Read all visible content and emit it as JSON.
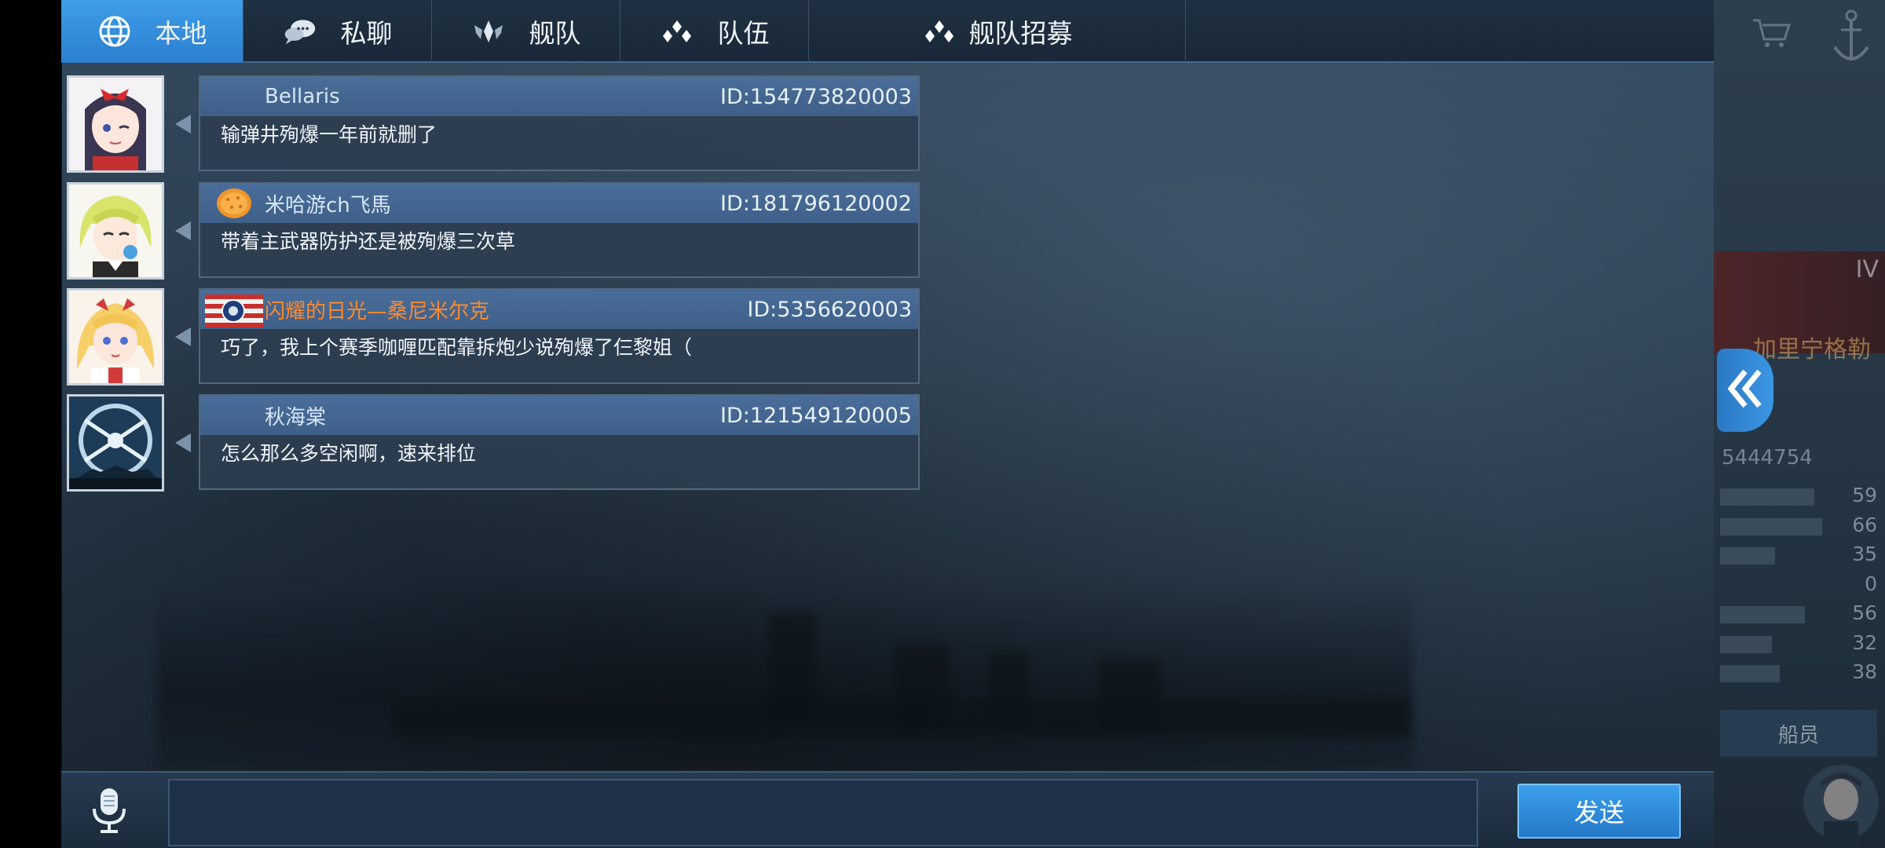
{
  "tabs": [
    {
      "label": "本地",
      "icon": "globe-icon",
      "active": true
    },
    {
      "label": "私聊",
      "icon": "chat-bubble-icon",
      "active": false
    },
    {
      "label": "舰队",
      "icon": "fleet-wings-icon",
      "active": false
    },
    {
      "label": "队伍",
      "icon": "team-dots-icon",
      "active": false
    },
    {
      "label": "舰队招募",
      "icon": "team-dots-icon",
      "active": false
    }
  ],
  "messages": [
    {
      "name": "Bellaris",
      "id": "ID:154773820003",
      "text": "输弹井殉爆一年前就删了",
      "name_color": "#d7e6f7",
      "badge": null
    },
    {
      "name": "米哈游ch飞馬",
      "id": "ID:181796120002",
      "text": "带着主武器防护还是被殉爆三次草",
      "name_color": "#d7e6f7",
      "badge": "orange-round-badge"
    },
    {
      "name": "闪耀的日光—桑尼米尔克",
      "id": "ID:5356620003",
      "text": "巧了，我上个赛季咖喱匹配靠拆炮少说殉爆了仨黎姐（",
      "name_color": "#ff8a2a",
      "badge": "us-flag-badge"
    },
    {
      "name": "秋海棠",
      "id": "ID:121549120005",
      "text": "怎么那么多空闲啊，速来排位",
      "name_color": "#d7e6f7",
      "badge": null
    }
  ],
  "composer": {
    "placeholder": "",
    "value": "",
    "send_label": "发送",
    "mic_icon": "microphone-icon"
  },
  "background_panel": {
    "roman_numeral": "IV",
    "ship_name": "加里宁格勒",
    "player_id": "5444754",
    "stat_values": [
      "59",
      "66",
      "35",
      "0",
      "56",
      "32",
      "38"
    ],
    "crew_label": "船员",
    "collapse_icon": "double-chevron-left-icon"
  }
}
